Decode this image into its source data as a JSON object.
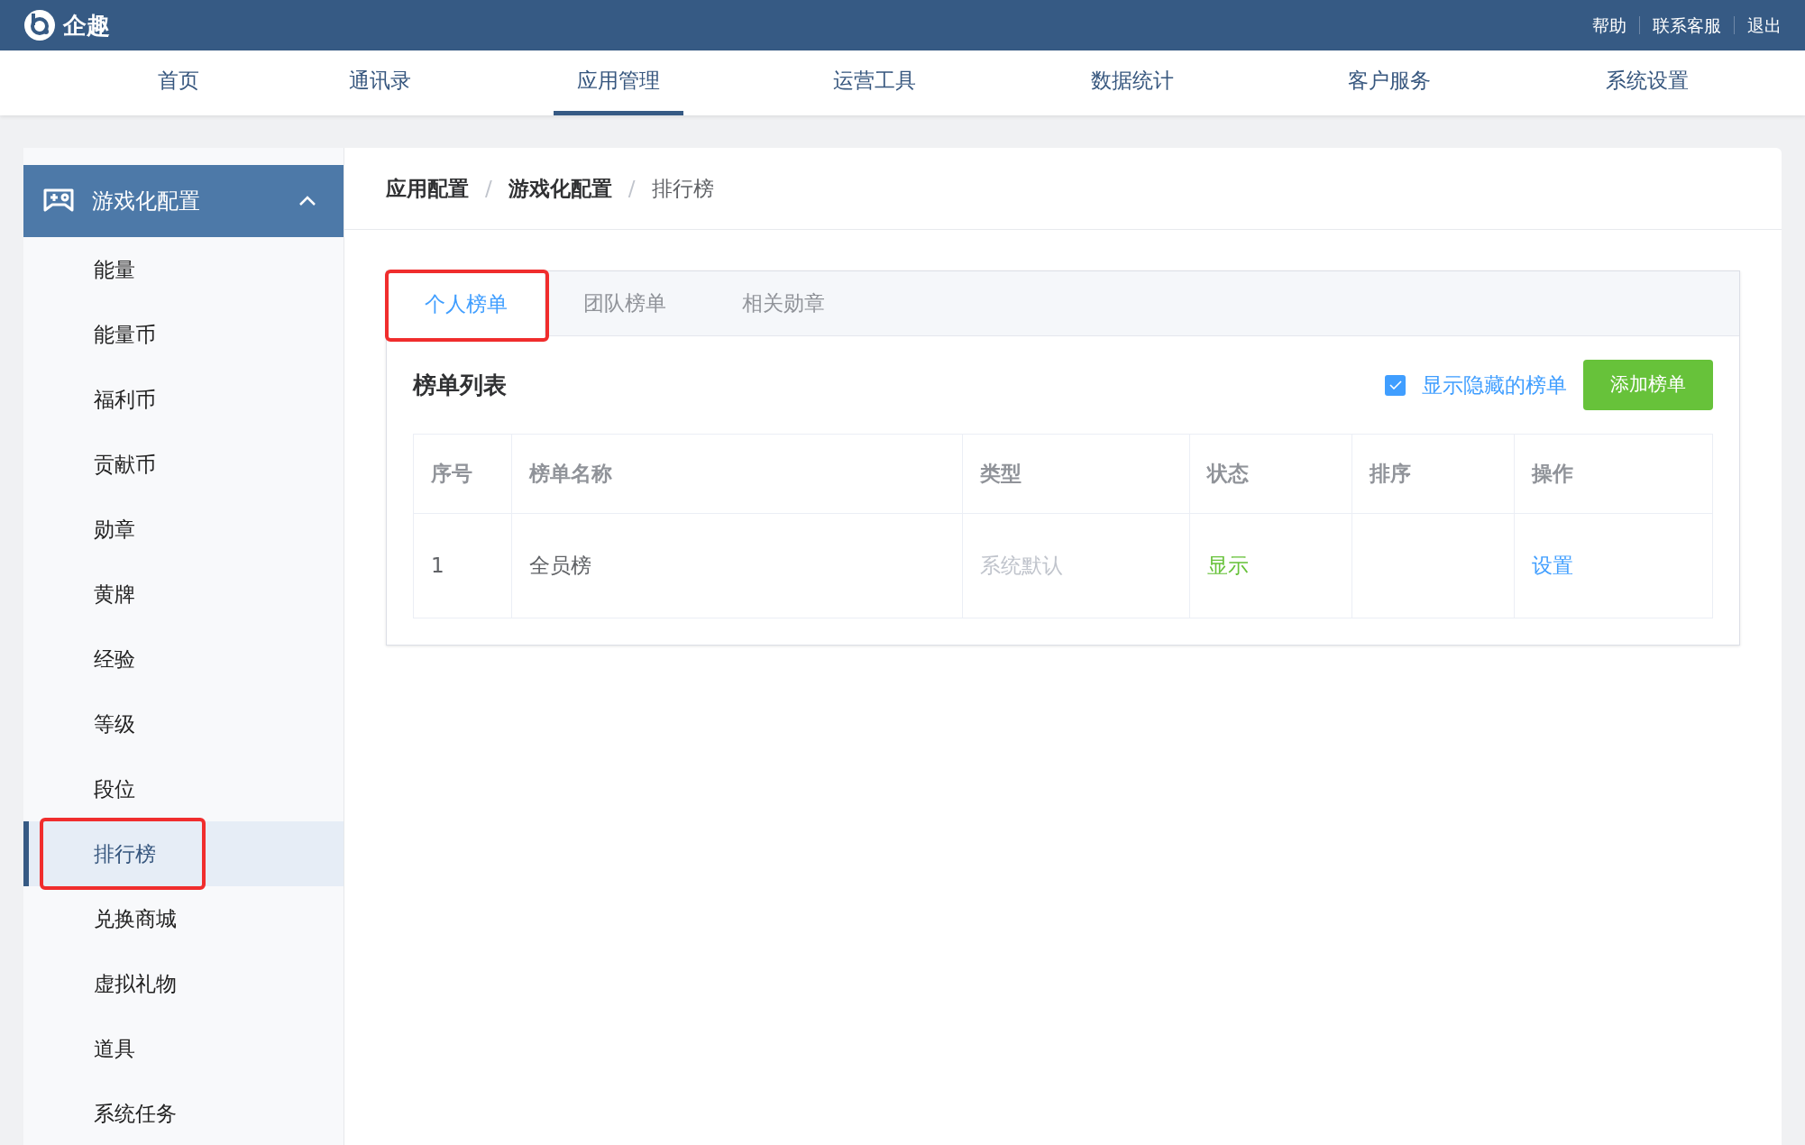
{
  "header": {
    "logo_text": "企趣",
    "links": [
      "帮助",
      "联系客服",
      "退出"
    ]
  },
  "nav": [
    {
      "label": "首页",
      "selected": false
    },
    {
      "label": "通讯录",
      "selected": false
    },
    {
      "label": "应用管理",
      "selected": true
    },
    {
      "label": "运营工具",
      "selected": false
    },
    {
      "label": "数据统计",
      "selected": false
    },
    {
      "label": "客户服务",
      "selected": false
    },
    {
      "label": "系统设置",
      "selected": false
    }
  ],
  "sidebar": {
    "group": {
      "label": "游戏化配置",
      "expanded": true
    },
    "items": [
      {
        "label": "能量",
        "selected": false,
        "highlighted": false
      },
      {
        "label": "能量币",
        "selected": false,
        "highlighted": false
      },
      {
        "label": "福利币",
        "selected": false,
        "highlighted": false
      },
      {
        "label": "贡献币",
        "selected": false,
        "highlighted": false
      },
      {
        "label": "勋章",
        "selected": false,
        "highlighted": false
      },
      {
        "label": "黄牌",
        "selected": false,
        "highlighted": false
      },
      {
        "label": "经验",
        "selected": false,
        "highlighted": false
      },
      {
        "label": "等级",
        "selected": false,
        "highlighted": false
      },
      {
        "label": "段位",
        "selected": false,
        "highlighted": false
      },
      {
        "label": "排行榜",
        "selected": true,
        "highlighted": true
      },
      {
        "label": "兑换商城",
        "selected": false,
        "highlighted": false
      },
      {
        "label": "虚拟礼物",
        "selected": false,
        "highlighted": false
      },
      {
        "label": "道具",
        "selected": false,
        "highlighted": false
      },
      {
        "label": "系统任务",
        "selected": false,
        "highlighted": false
      }
    ]
  },
  "breadcrumb": [
    {
      "label": "应用配置",
      "current": false
    },
    {
      "label": "游戏化配置",
      "current": false
    },
    {
      "label": "排行榜",
      "current": true
    }
  ],
  "breadcrumb_separators": [
    "/",
    "/"
  ],
  "tabs": [
    {
      "label": "个人榜单",
      "selected": true,
      "highlighted": true
    },
    {
      "label": "团队榜单",
      "selected": false,
      "highlighted": false
    },
    {
      "label": "相关勋章",
      "selected": false,
      "highlighted": false
    }
  ],
  "list": {
    "title": "榜单列表",
    "show_hidden": {
      "label": "显示隐藏的榜单",
      "checked": true
    },
    "add_button": "添加榜单"
  },
  "table": {
    "columns": [
      "序号",
      "榜单名称",
      "类型",
      "状态",
      "排序",
      "操作"
    ],
    "rows": [
      {
        "index": "1",
        "name": "全员榜",
        "type": "系统默认",
        "status": {
          "label": "显示",
          "kind": "visible"
        },
        "sort": "",
        "action": "设置"
      }
    ]
  }
}
